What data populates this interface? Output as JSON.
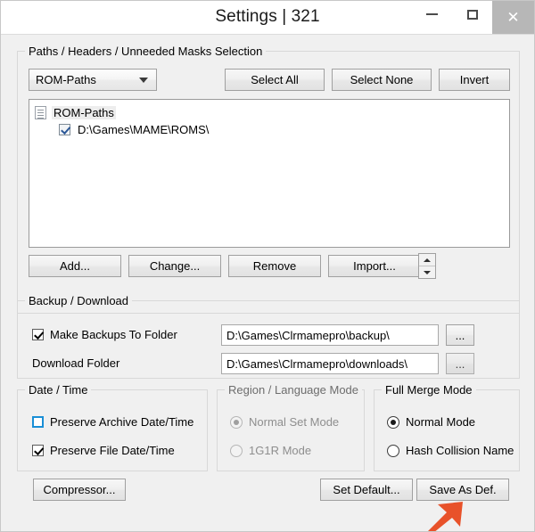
{
  "window": {
    "title": "Settings | 321",
    "minimize_label": "–",
    "maximize_label": "□",
    "close_label": "✕"
  },
  "paths_group": {
    "legend": "Paths / Headers / Unneeded Masks Selection",
    "combo_value": "ROM-Paths",
    "select_all": "Select All",
    "select_none": "Select None",
    "invert": "Invert",
    "tree": {
      "root_label": "ROM-Paths",
      "items": [
        {
          "label": "D:\\Games\\MAME\\ROMS\\",
          "checked": true
        }
      ]
    },
    "buttons": {
      "add": "Add...",
      "change": "Change...",
      "remove": "Remove",
      "import": "Import..."
    }
  },
  "backup_group": {
    "legend": "Backup / Download",
    "make_backups_label": "Make Backups To Folder",
    "make_backups_checked": true,
    "backup_path": "D:\\Games\\Clrmamepro\\backup\\",
    "download_label": "Download Folder",
    "download_path": "D:\\Games\\Clrmamepro\\downloads\\",
    "browse_label": "..."
  },
  "date_time_group": {
    "legend": "Date / Time",
    "preserve_archive_label": "Preserve Archive Date/Time",
    "preserve_archive_checked": false,
    "preserve_file_label": "Preserve File Date/Time",
    "preserve_file_checked": true
  },
  "region_group": {
    "legend": "Region / Language Mode",
    "disabled": true,
    "options": [
      {
        "label": "Normal Set Mode",
        "selected": true
      },
      {
        "label": "1G1R Mode",
        "selected": false
      }
    ]
  },
  "merge_group": {
    "legend": "Full Merge Mode",
    "options": [
      {
        "label": "Normal Mode",
        "selected": true
      },
      {
        "label": "Hash Collision Name",
        "selected": false
      }
    ]
  },
  "footer": {
    "compressor": "Compressor...",
    "set_default": "Set Default...",
    "save_as_def": "Save As Def."
  },
  "annotation": {
    "arrow_color": "#e8522a",
    "points_at": "Save As Def."
  }
}
